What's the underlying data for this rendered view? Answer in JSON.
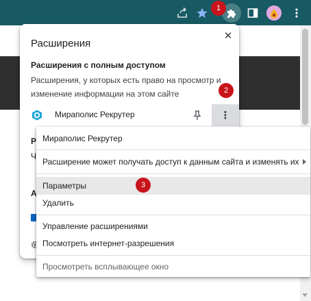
{
  "browser": {
    "toolbar_color": "#185a63",
    "icons": [
      "share-icon",
      "bookmark-star-icon",
      "extensions-puzzle-icon",
      "side-panel-icon",
      "profile-avatar",
      "kebab-menu-icon"
    ]
  },
  "panel": {
    "title": "Расширения",
    "close_glyph": "✕",
    "section_title": "Расширения с полным доступом",
    "section_desc": "Расширения, у которых есть право на просмотр и изменение информации на этом сайте",
    "extension": {
      "name": "Мираполис Рекрутер",
      "more_glyph": "⋮"
    },
    "partial_letters": [
      "Р",
      "Ч",
      "А"
    ]
  },
  "menu": {
    "items": [
      {
        "label": "Мираполис Рекрутер"
      },
      {
        "label": "Расширение может получать доступ к данным сайта и изменять их"
      },
      {
        "label": "Параметры"
      },
      {
        "label": "Удалить"
      },
      {
        "label": "Управление расширениями"
      },
      {
        "label": "Посмотреть интернет-разрешения"
      },
      {
        "label": "Просмотреть всплывающее окно"
      }
    ]
  },
  "badges": [
    "1",
    "2",
    "3"
  ],
  "colors": {
    "badge": "#c8141b",
    "accent": "#1a73e8",
    "menu_hover": "#e8e8e8"
  }
}
